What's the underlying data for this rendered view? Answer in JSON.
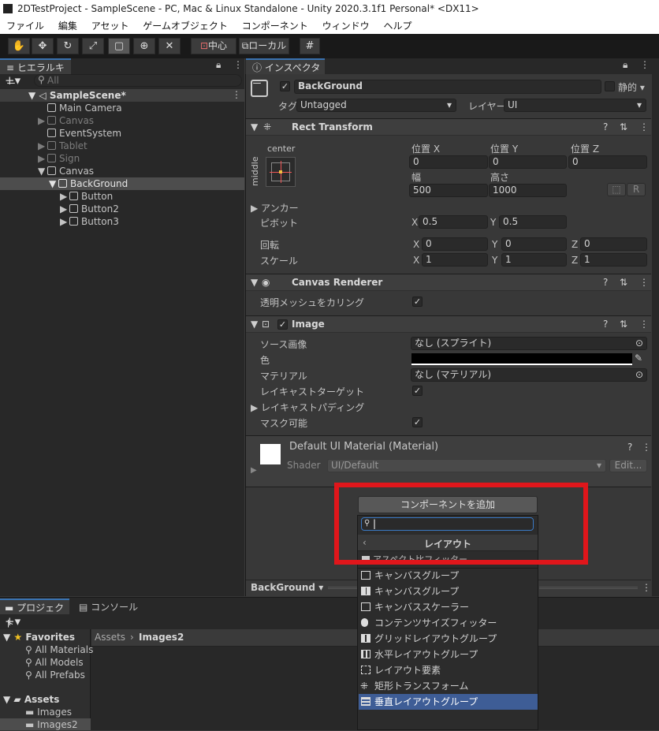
{
  "window": {
    "title": "2DTestProject - SampleScene - PC, Mac & Linux Standalone - Unity 2020.3.1f1 Personal* <DX11>"
  },
  "menu": [
    "ファイル",
    "編集",
    "アセット",
    "ゲームオブジェクト",
    "コンポーネント",
    "ウィンドウ",
    "ヘルプ"
  ],
  "toolbar": {
    "pivot_label": "中心",
    "space_label": "ローカル"
  },
  "hierarchy": {
    "tab": "ヒエラルキー",
    "search_placeholder": "All",
    "scene": "SampleScene*",
    "items": [
      {
        "label": "Main Camera",
        "active": true,
        "fold": ""
      },
      {
        "label": "Canvas",
        "active": false,
        "fold": "▶"
      },
      {
        "label": "EventSystem",
        "active": true,
        "fold": ""
      },
      {
        "label": "Tablet",
        "active": false,
        "fold": "▶"
      },
      {
        "label": "Sign",
        "active": false,
        "fold": "▶"
      },
      {
        "label": "Canvas",
        "active": true,
        "fold": "▼"
      },
      {
        "label": "BackGround",
        "active": true,
        "fold": "▼"
      },
      {
        "label": "Button",
        "active": true,
        "fold": "▶"
      },
      {
        "label": "Button2",
        "active": true,
        "fold": "▶"
      },
      {
        "label": "Button3",
        "active": true,
        "fold": "▶"
      }
    ]
  },
  "inspector": {
    "tab": "インスペクター",
    "object_name": "BackGround",
    "static_label": "静的",
    "tag_label": "タグ",
    "tag_value": "Untagged",
    "layer_label": "レイヤー",
    "layer_value": "UI",
    "rect": {
      "title": "Rect Transform",
      "anchor_h": "center",
      "anchor_v": "middle",
      "pos_x_label": "位置 X",
      "pos_y_label": "位置 Y",
      "pos_z_label": "位置 Z",
      "pos_x": "0",
      "pos_y": "0",
      "pos_z": "0",
      "width_label": "幅",
      "height_label": "高さ",
      "width": "500",
      "height": "1000",
      "r_button": "R",
      "anchor_label": "アンカー",
      "pivot_label": "ピボット",
      "pivot_x": "0.5",
      "pivot_y": "0.5",
      "rotation_label": "回転",
      "rot_x": "0",
      "rot_y": "0",
      "rot_z": "0",
      "scale_label": "スケール",
      "scale_x": "1",
      "scale_y": "1",
      "scale_z": "1",
      "x": "X",
      "y": "Y",
      "z": "Z"
    },
    "canvas_renderer": {
      "title": "Canvas Renderer",
      "cull_label": "透明メッシュをカリング"
    },
    "image": {
      "title": "Image",
      "source_label": "ソース画像",
      "source_value": "なし (スプライト)",
      "color_label": "色",
      "material_label": "マテリアル",
      "material_value": "なし (マテリアル)",
      "raycast_target_label": "レイキャストターゲット",
      "raycast_padding_label": "レイキャストパディング",
      "maskable_label": "マスク可能"
    },
    "material": {
      "title": "Default UI Material (Material)",
      "shader_label": "Shader",
      "shader_value": "UI/Default",
      "edit_button": "Edit..."
    },
    "add_component": "コンポーネントを追加",
    "footer_name": "BackGround"
  },
  "dropdown": {
    "header": "レイアウト",
    "search_value": "",
    "partial_item": "アスペクト比フィッター",
    "items": [
      "キャンバスグループ",
      "キャンバスグループ",
      "キャンバススケーラー",
      "コンテンツサイズフィッター",
      "グリッドレイアウトグループ",
      "水平レイアウトグループ",
      "レイアウト要素",
      "矩形トランスフォーム",
      "垂直レイアウトグループ"
    ],
    "selected_index": 8
  },
  "project": {
    "tab_project": "プロジェクト",
    "tab_console": "コンソール",
    "favorites": "Favorites",
    "fav_items": [
      "All Materials",
      "All Models",
      "All Prefabs"
    ],
    "assets": "Assets",
    "asset_items": [
      "Images",
      "Images2"
    ],
    "breadcrumb_root": "Assets",
    "breadcrumb_current": "Images2"
  },
  "colors": {
    "highlight_box": "#e0161b",
    "selection": "#3e5d96",
    "accent": "#3a72b0"
  }
}
